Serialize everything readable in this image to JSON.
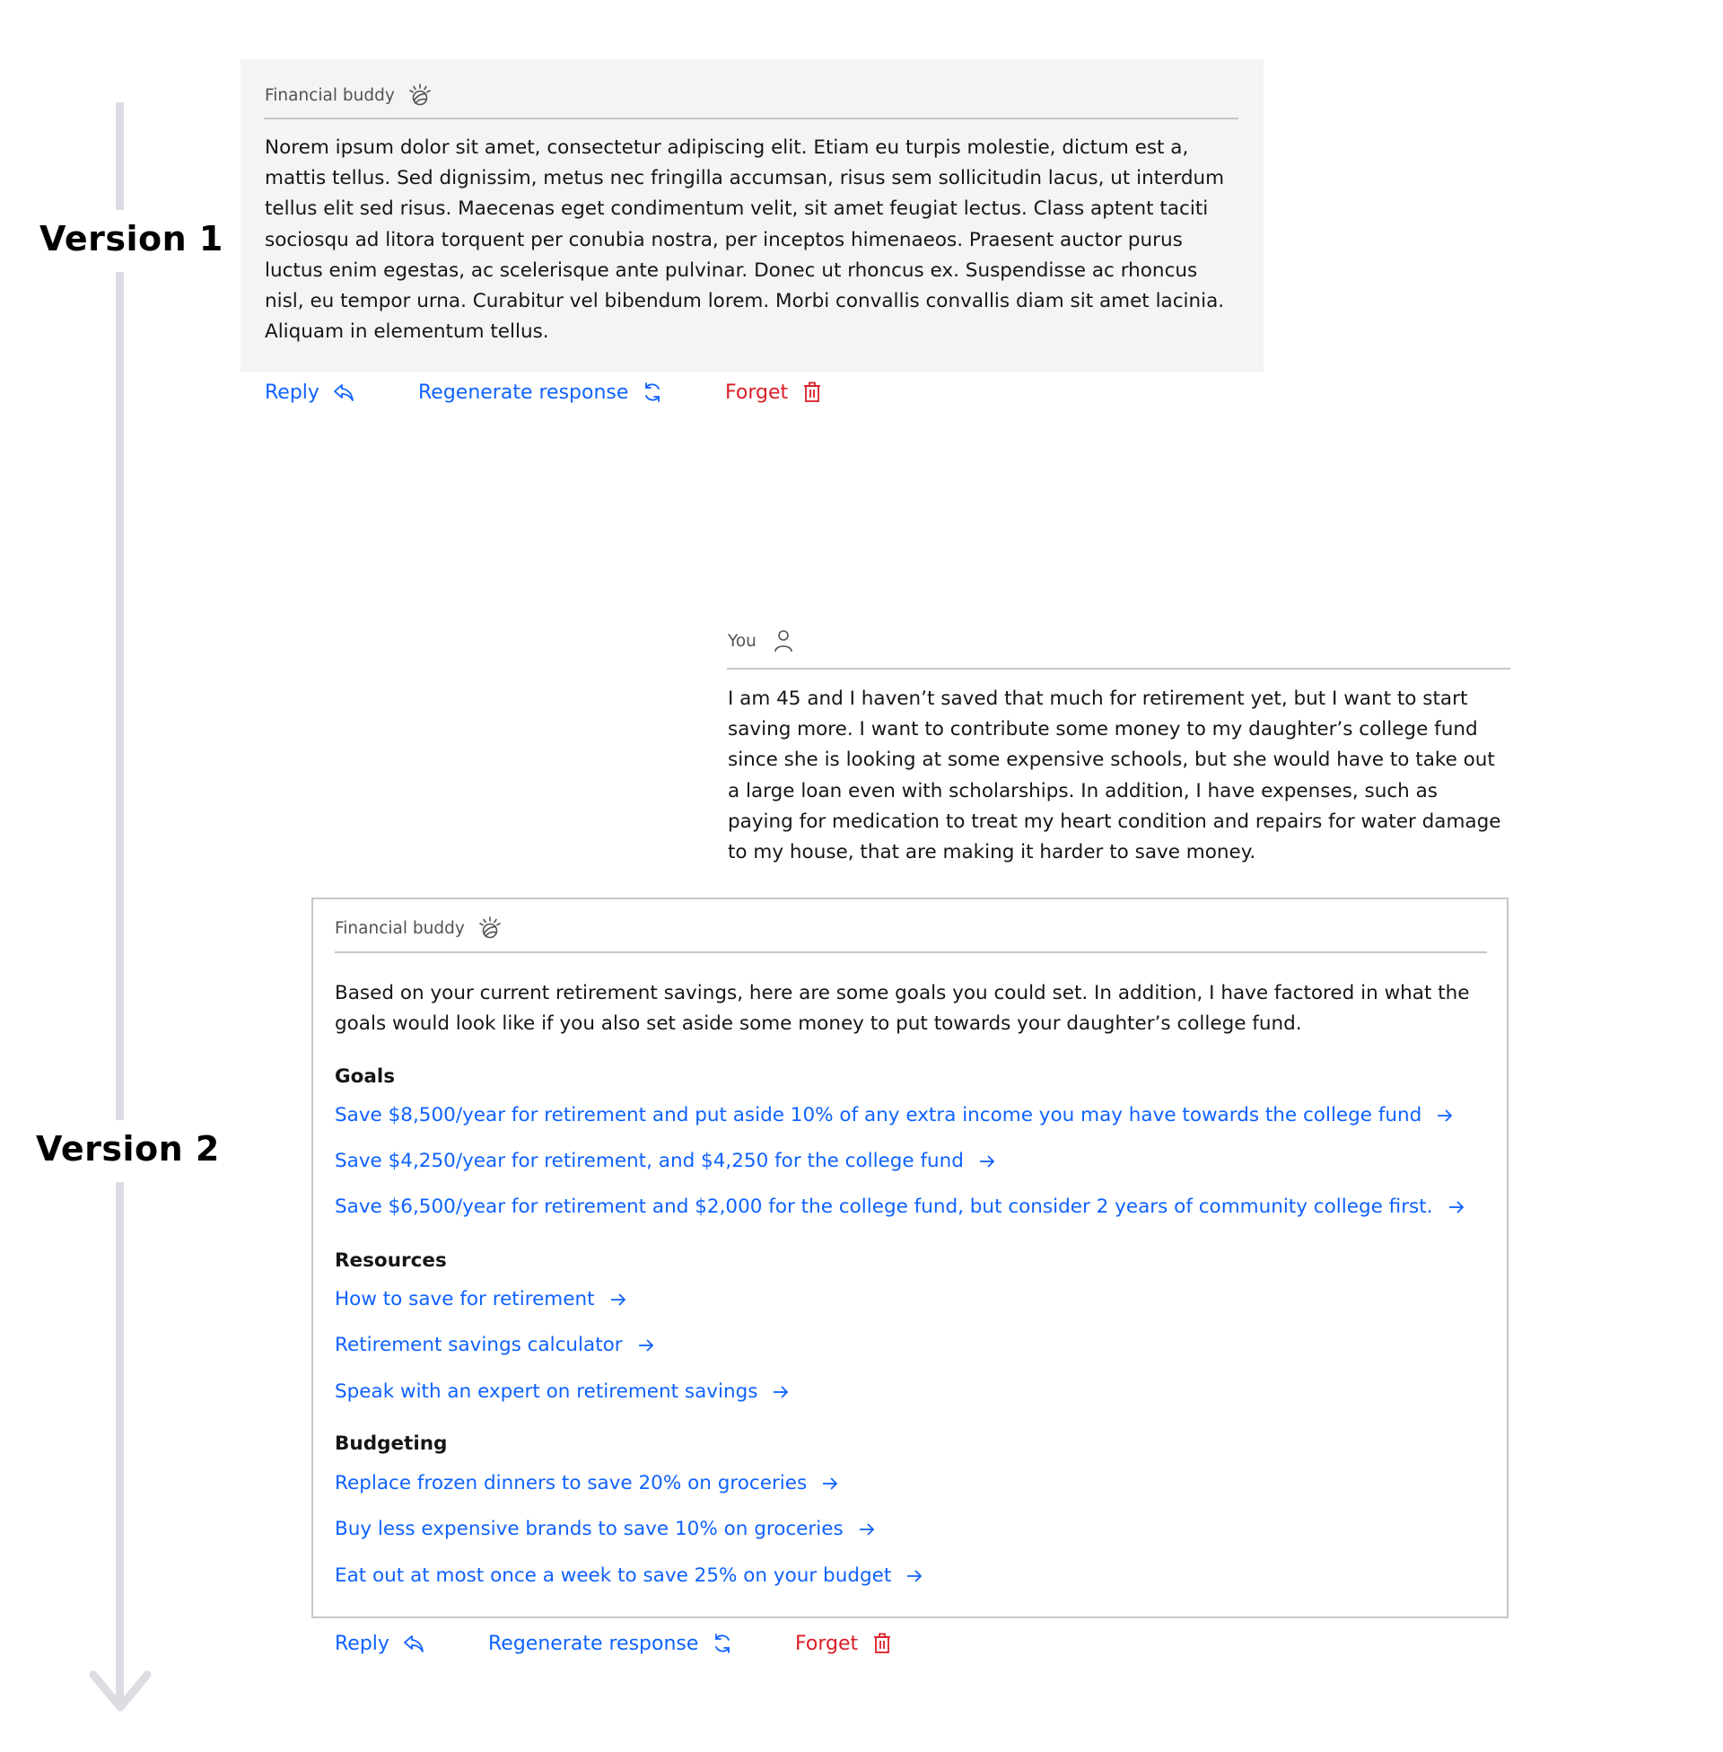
{
  "timeline": {
    "labels": [
      "Version 1",
      "Version 2"
    ]
  },
  "colors": {
    "link": "#0f62fe",
    "danger": "#da1e28",
    "text": "#161616",
    "muted": "#525252",
    "card_bg": "#f4f4f4",
    "timeline": "#dcdde2"
  },
  "version1": {
    "sender": "Financial buddy",
    "sender_icon": "watson-bulb-icon",
    "message_lines": [
      "Norem ipsum dolor sit amet, consectetur adipiscing elit. Etiam eu turpis molestie, dictum est a,",
      "mattis tellus. Sed dignissim, metus nec fringilla accumsan, risus sem sollicitudin lacus, ut interdum",
      "tellus elit sed risus. Maecenas eget condimentum velit, sit amet feugiat lectus. Class aptent taciti",
      "sociosqu ad litora torquent per conubia nostra, per inceptos himenaeos. Praesent auctor purus",
      "luctus enim egestas, ac scelerisque ante pulvinar. Donec ut rhoncus ex. Suspendisse ac rhoncus",
      "nisl, eu tempor urna. Curabitur vel bibendum lorem. Morbi convallis convallis diam sit amet lacinia.",
      "Aliquam in elementum tellus."
    ],
    "actions": {
      "reply": "Reply",
      "regenerate": "Regenerate response",
      "forget": "Forget"
    }
  },
  "user": {
    "sender": "You",
    "sender_icon": "user-icon",
    "message_lines": [
      "I am 45 and I haven’t saved that much for retirement yet, but I want to start",
      "saving more. I want to contribute some money to my daughter’s college fund",
      "since she is looking at some expensive schools, but she would have to take out",
      "a large loan even with scholarships. In addition, I have expenses, such as",
      "paying for medication to treat my heart condition and repairs for water damage",
      "to my house, that are making it harder to save money."
    ]
  },
  "version2": {
    "sender": "Financial buddy",
    "sender_icon": "watson-bulb-icon",
    "intro_lines": [
      "Based on your current retirement savings, here are some goals you could set. In addition, I have factored in what the",
      "goals would look like if you also set aside some money to put towards your daughter’s college fund."
    ],
    "sections": [
      {
        "title": "Goals",
        "links": [
          "Save $8,500/year for retirement and put aside 10% of any extra income you may have towards the college fund",
          "Save $4,250/year for retirement, and $4,250 for the college fund",
          "Save $6,500/year for retirement and $2,000 for the college fund, but consider 2 years of community college first."
        ]
      },
      {
        "title": "Resources",
        "links": [
          "How to save for retirement",
          "Retirement savings calculator",
          "Speak with an expert on retirement savings"
        ]
      },
      {
        "title": "Budgeting",
        "links": [
          "Replace frozen dinners to save 20% on groceries",
          "Buy less expensive brands to save 10% on groceries",
          "Eat out at most once a week to save 25% on your budget"
        ]
      }
    ],
    "actions": {
      "reply": "Reply",
      "regenerate": "Regenerate response",
      "forget": "Forget"
    }
  }
}
